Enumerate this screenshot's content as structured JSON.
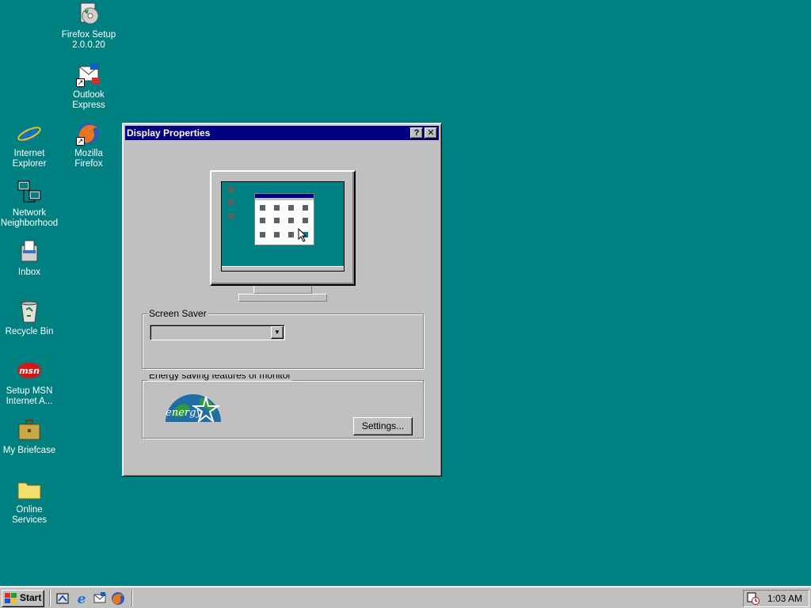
{
  "desktop": {
    "icons": [
      {
        "label": "Firefox Setup 2.0.0.20",
        "icon": "firefox-setup-icon"
      },
      {
        "label": "Outlook Express",
        "icon": "outlook-express-icon"
      },
      {
        "label": "Internet Explorer",
        "icon": "internet-explorer-icon"
      },
      {
        "label": "Mozilla Firefox",
        "icon": "mozilla-firefox-icon"
      },
      {
        "label": "Network Neighborhood",
        "icon": "network-neighborhood-icon"
      },
      {
        "label": "Inbox",
        "icon": "inbox-icon"
      },
      {
        "label": "Recycle Bin",
        "icon": "recycle-bin-icon"
      },
      {
        "label": "Setup MSN Internet A...",
        "icon": "msn-icon"
      },
      {
        "label": "My Briefcase",
        "icon": "briefcase-icon"
      },
      {
        "label": "Online Services",
        "icon": "folder-icon"
      }
    ]
  },
  "window": {
    "title": "Display Properties",
    "help_button": "?",
    "close_button": "✕",
    "screen_saver": {
      "legend": "Screen Saver",
      "selected_value": ""
    },
    "energy": {
      "legend": "Energy saving features of monitor",
      "logo_text": "energy",
      "settings_button": "Settings..."
    }
  },
  "taskbar": {
    "start_label": "Start",
    "quick_launch": [
      "show-desktop-icon",
      "internet-explorer-icon",
      "outlook-express-icon",
      "mozilla-firefox-icon"
    ],
    "clock": "1:03 AM"
  },
  "colors": {
    "desktop": "#008080",
    "titlebar": "#000080",
    "face": "#c0c0c0"
  }
}
